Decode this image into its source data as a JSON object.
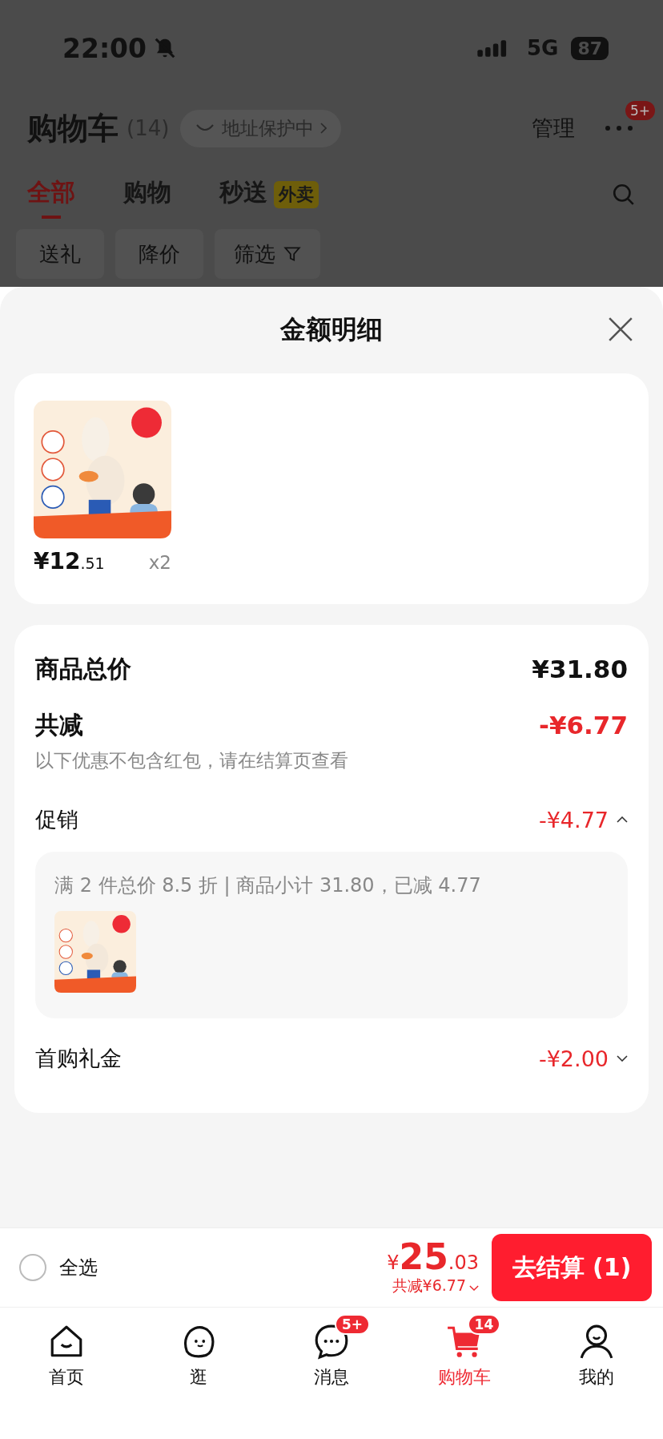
{
  "status_bar": {
    "time": "22:00",
    "network": "5G",
    "battery": "87"
  },
  "header": {
    "title": "购物车",
    "count": "(14)",
    "address_pill": "地址保护中",
    "manage": "管理",
    "more_badge": "5+"
  },
  "tabs": [
    {
      "label": "全部",
      "selected": true
    },
    {
      "label": "购物",
      "selected": false
    },
    {
      "label": "秒送",
      "tag": "外卖",
      "selected": false
    }
  ],
  "filters": [
    {
      "label": "送礼",
      "kind": "text"
    },
    {
      "label": "降价",
      "kind": "text"
    },
    {
      "label": "筛选",
      "kind": "filter"
    }
  ],
  "sheet": {
    "title": "金额明细",
    "product": {
      "price_integer": "¥12",
      "price_decimal": ".51",
      "quantity": "x2"
    },
    "rows": [
      {
        "kind": "total",
        "label": "商品总价",
        "amount": "¥31.80"
      },
      {
        "kind": "discount",
        "label": "共减",
        "amount": "-¥6.77",
        "note": "以下优惠不包含红包，请在结算页查看"
      },
      {
        "kind": "promo",
        "label": "促销",
        "amount": "-¥4.77",
        "expanded": true,
        "detail": "满 2 件总价 8.5 折 | 商品小计 31.80，已减 4.77"
      },
      {
        "kind": "promo",
        "label": "首购礼金",
        "amount": "-¥2.00",
        "expanded": false
      }
    ]
  },
  "checkout_bar": {
    "select_all": {
      "label": "全选",
      "checked": false
    },
    "total": {
      "currency": "¥",
      "integer": "25",
      "decimal": ".03"
    },
    "savings": "共减¥6.77",
    "button": "去结算 (1)"
  },
  "nav": [
    {
      "label": "首页",
      "selected": false
    },
    {
      "label": "逛",
      "selected": false
    },
    {
      "label": "消息",
      "badge": "5+",
      "selected": false
    },
    {
      "label": "购物车",
      "badge": "14",
      "selected": true
    },
    {
      "label": "我的",
      "selected": false
    }
  ]
}
